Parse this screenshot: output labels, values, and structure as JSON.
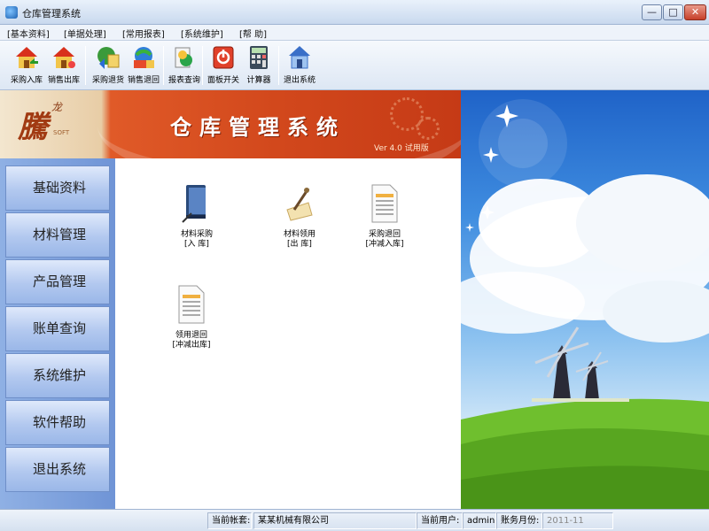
{
  "window": {
    "title": "仓库管理系统",
    "controls": {
      "minimize": "—",
      "maximize": "□",
      "close": "✕"
    }
  },
  "menu": [
    "[基本资料]",
    "[单据处理]",
    "[常用报表]",
    "[系统维护]",
    "[帮  助]"
  ],
  "toolbar": [
    {
      "label": "采购入库",
      "icon": "house-in-icon"
    },
    {
      "label": "销售出库",
      "icon": "house-out-icon"
    },
    {
      "label": "采购退货",
      "icon": "purchase-return-icon"
    },
    {
      "label": "销售退回",
      "icon": "sales-return-icon"
    },
    {
      "label": "报表查询",
      "icon": "report-query-icon"
    },
    {
      "label": "面板开关",
      "icon": "power-icon"
    },
    {
      "label": "计算器",
      "icon": "calculator-icon"
    },
    {
      "label": "退出系统",
      "icon": "exit-icon"
    }
  ],
  "banner": {
    "logo": "騰",
    "logo_small": "龙",
    "logo_sub": "SOFT",
    "title": "仓库管理系统",
    "version": "Ver 4.0 试用版"
  },
  "sidebar": [
    "基础资料",
    "材料管理",
    "产品管理",
    "账单查询",
    "系统维护",
    "软件帮助",
    "退出系统"
  ],
  "content": {
    "items": [
      {
        "line1": "材料采购",
        "line2": "[入  库]",
        "icon": "book-icon"
      },
      {
        "line1": "材料领用",
        "line2": "[出  库]",
        "icon": "quill-icon"
      },
      {
        "line1": "采购退回",
        "line2": "[冲减入库]",
        "icon": "document-icon"
      },
      {
        "line1": "领用退回",
        "line2": "[冲减出库]",
        "icon": "document-icon"
      }
    ]
  },
  "status": {
    "account_label": "当前帐套:",
    "account_value": "某某机械有限公司",
    "user_label": "当前用户:",
    "user_value": "admin",
    "period_label": "账务月份:",
    "period_value": "2011-11"
  },
  "colors": {
    "banner_red": "#d2481c",
    "sidebar_blue": "#7a9cdc",
    "sky_blue": "#3f8de0",
    "grass_green": "#6fbf2e"
  }
}
